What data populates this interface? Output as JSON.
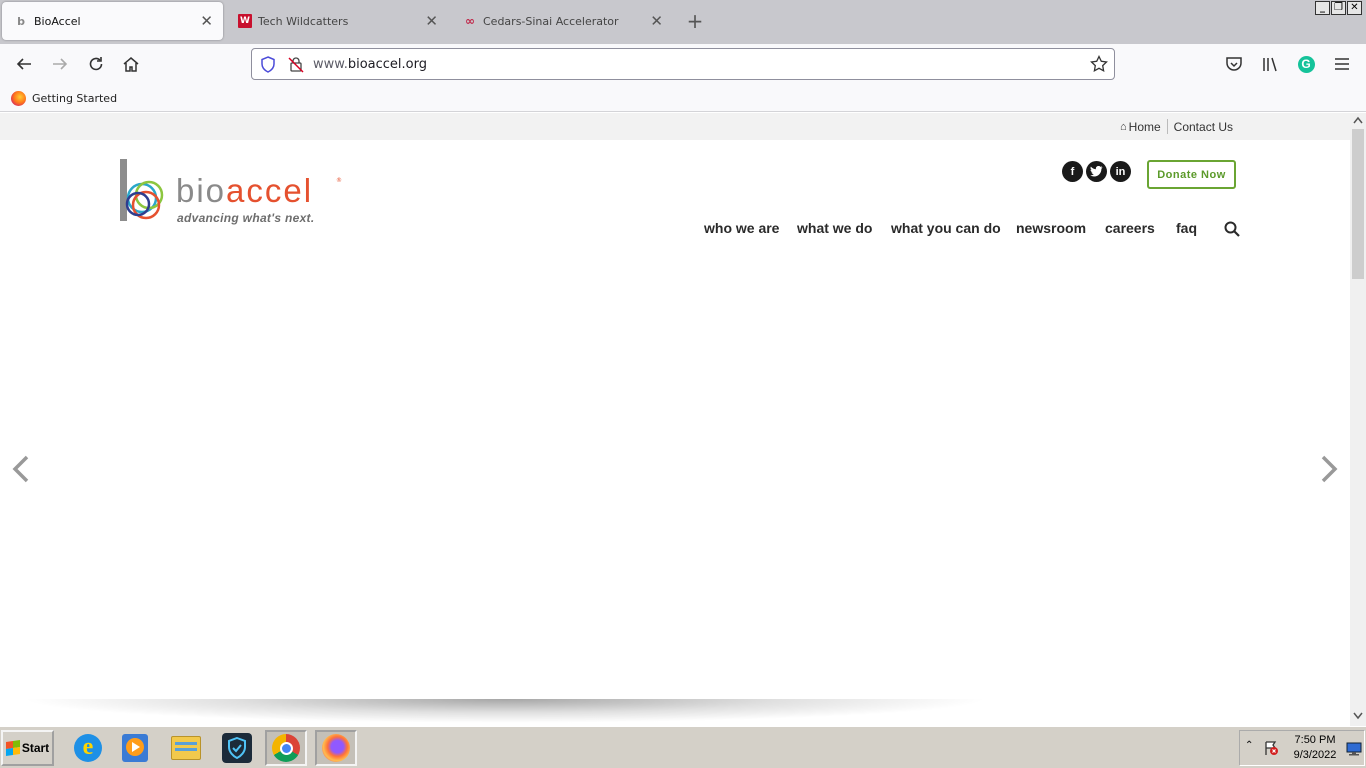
{
  "browser": {
    "tabs": [
      {
        "title": "BioAccel",
        "active": true
      },
      {
        "title": "Tech Wildcatters",
        "active": false
      },
      {
        "title": "Cedars-Sinai Accelerator",
        "active": false
      }
    ],
    "url_prefix": "www.",
    "url_domain": "bioaccel.org",
    "bookmarks": [
      {
        "label": "Getting Started"
      }
    ]
  },
  "site": {
    "top_links": {
      "home": "Home",
      "contact": "Contact Us"
    },
    "logo": {
      "word_bio": "bio",
      "word_accel": "accel",
      "tagline": "advancing what's next."
    },
    "social": {
      "facebook": "f",
      "twitter": "t",
      "linkedin": "in"
    },
    "donate_label": "Donate Now",
    "nav": {
      "who": "who we are",
      "what": "what we do",
      "you": "what you can do",
      "news": "newsroom",
      "careers": "careers",
      "faq": "faq"
    }
  },
  "taskbar": {
    "start_label": "Start",
    "clock_time": "7:50 PM",
    "clock_date": "9/3/2022"
  },
  "colors": {
    "accent_orange": "#e5512f",
    "donate_green": "#6aa533",
    "logo_gray": "#8a8a8a"
  }
}
